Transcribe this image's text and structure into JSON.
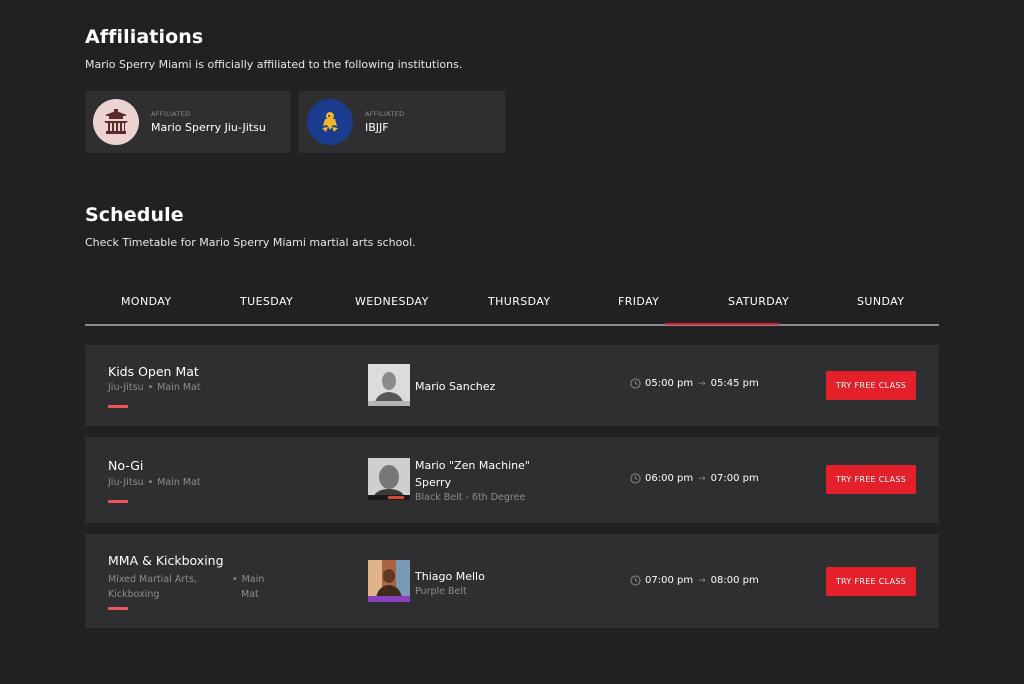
{
  "affiliations": {
    "title": "Affiliations",
    "description": "Mario Sperry Miami is officially affiliated to the following institutions.",
    "items": [
      {
        "label": "AFFILIATED",
        "name": "Mario Sperry Jiu-Jitsu",
        "logo_icon": "pagoda-icon",
        "logo_bg": "#ecd3d1"
      },
      {
        "label": "AFFILIATED",
        "name": "IBJJF",
        "logo_icon": "ibjjf-emblem-icon",
        "logo_bg": "#1b3b8f"
      }
    ]
  },
  "schedule": {
    "title": "Schedule",
    "description": "Check Timetable for Mario Sperry Miami martial arts school.",
    "days": [
      "MONDAY",
      "TUESDAY",
      "WEDNESDAY",
      "THURSDAY",
      "FRIDAY",
      "SATURDAY",
      "SUNDAY"
    ],
    "active_day": "FRIDAY",
    "classes": [
      {
        "name": "Kids Open Mat",
        "style": "Jiu-Jitsu",
        "location": "Main Mat",
        "instructor": "Mario Sanchez",
        "rank": "",
        "start": "05:00 pm",
        "end": "05:45 pm",
        "cta": "TRY FREE CLASS"
      },
      {
        "name": "No-Gi",
        "style": "Jiu-Jitsu",
        "location": "Main Mat",
        "instructor_line1": "Mario \"Zen Machine\"",
        "instructor_line2": "Sperry",
        "rank": "Black Belt - 6th Degree",
        "start": "06:00 pm",
        "end": "07:00 pm",
        "cta": "TRY FREE CLASS"
      },
      {
        "name": "MMA & Kickboxing",
        "style_line1": "Mixed Martial Arts,",
        "style_line2": "Kickboxing",
        "location_line1": "Main",
        "location_line2": "Mat",
        "instructor": "Thiago Mello",
        "rank": "Purple Belt",
        "start": "07:00 pm",
        "end": "08:00 pm",
        "cta": "TRY FREE CLASS"
      }
    ]
  },
  "colors": {
    "background": "#212022",
    "card": "#2f2e31",
    "accent": "#e4212b",
    "accent_bar": "#f0555e",
    "muted_text": "#8d8c90"
  }
}
